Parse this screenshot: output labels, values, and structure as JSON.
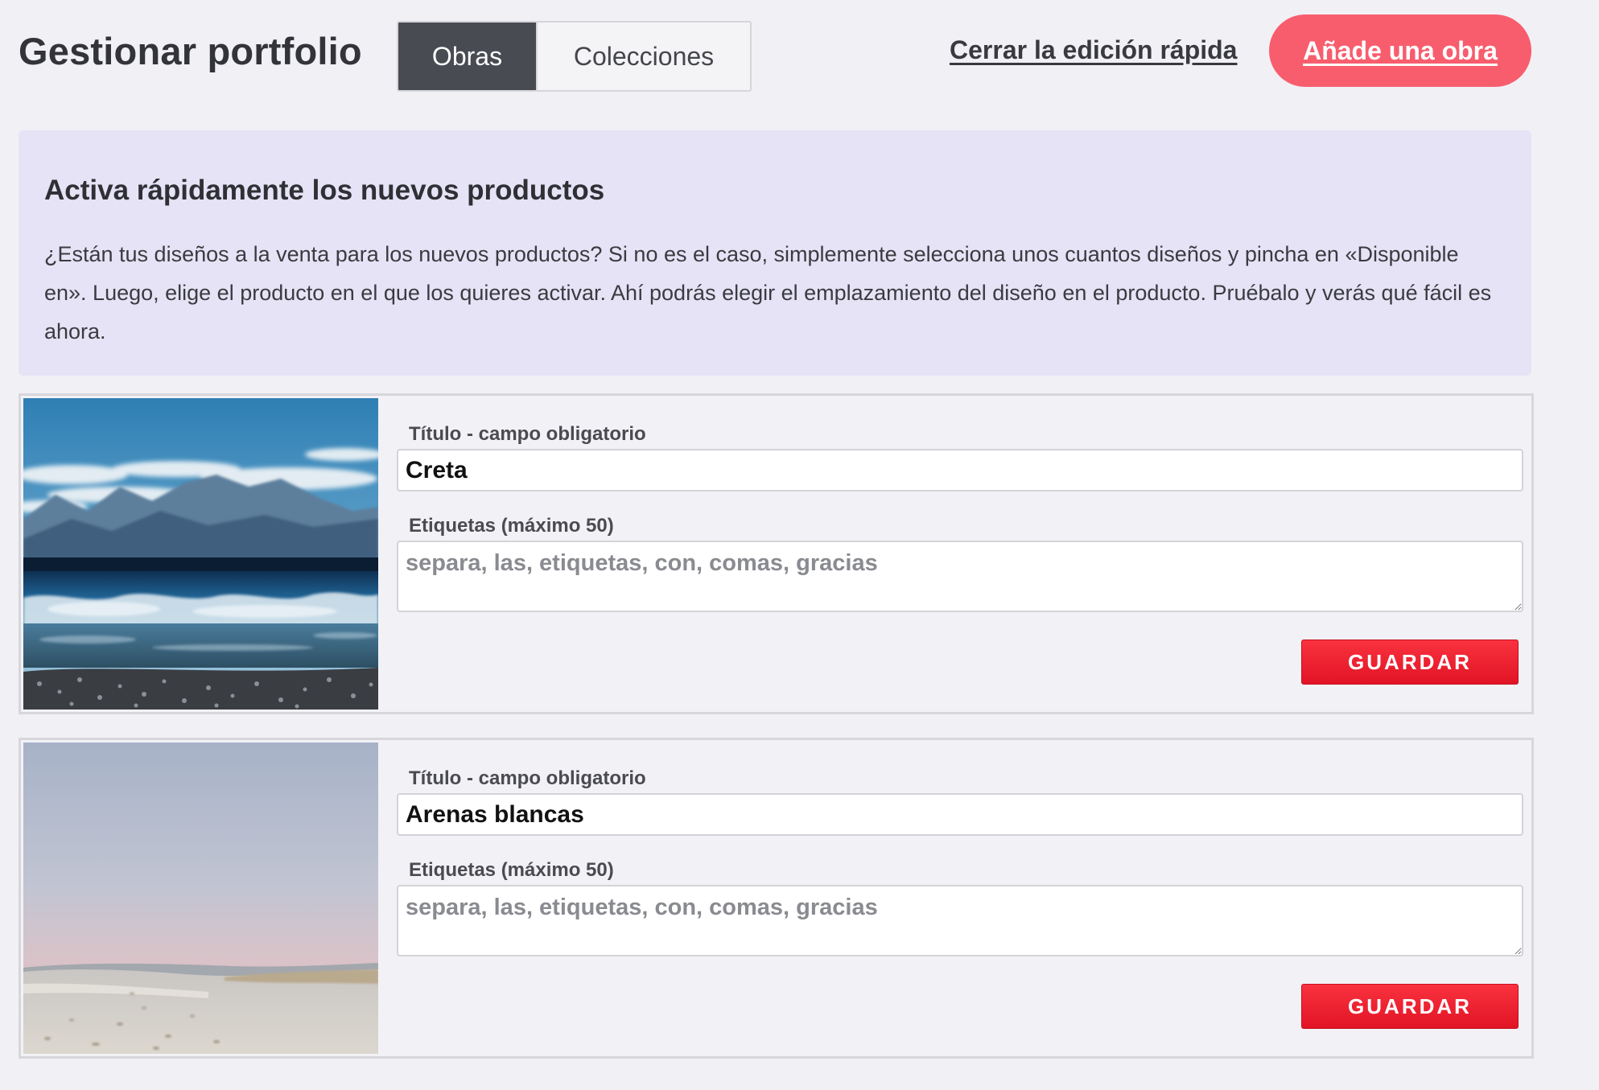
{
  "header": {
    "title": "Gestionar portfolio",
    "tabs": [
      {
        "label": "Obras",
        "active": true
      },
      {
        "label": "Colecciones",
        "active": false
      }
    ],
    "close_quick_edit_label": "Cerrar la edición rápida",
    "add_work_label": "Añade una obra"
  },
  "info": {
    "title": "Activa rápidamente los nuevos productos",
    "text": "¿Están tus diseños a la venta para los nuevos productos? Si no es el caso, simplemente selecciona unos cuantos diseños y pincha en «Disponible en». Luego, elige el producto en el que los quieres activar. Ahí podrás elegir el emplazamiento del diseño en el producto. Pruébalo y verás qué fácil es ahora."
  },
  "artworks": [
    {
      "title_label": "Título - campo obligatorio",
      "title_value": "Creta",
      "tags_label": "Etiquetas (máximo 50)",
      "tags_placeholder": "separa, las, etiquetas, con, comas, gracias",
      "save_label": "GUARDAR"
    },
    {
      "title_label": "Título - campo obligatorio",
      "title_value": "Arenas blancas",
      "tags_label": "Etiquetas (máximo 50)",
      "tags_placeholder": "separa, las, etiquetas, con, comas, gracias",
      "save_label": "GUARDAR"
    }
  ],
  "colors": {
    "page_background": "#f1f0f5",
    "tab_active": "#494b53",
    "add_button": "#f85d6d",
    "info_background": "#e6e3f6",
    "save_button": "#e8202f"
  }
}
